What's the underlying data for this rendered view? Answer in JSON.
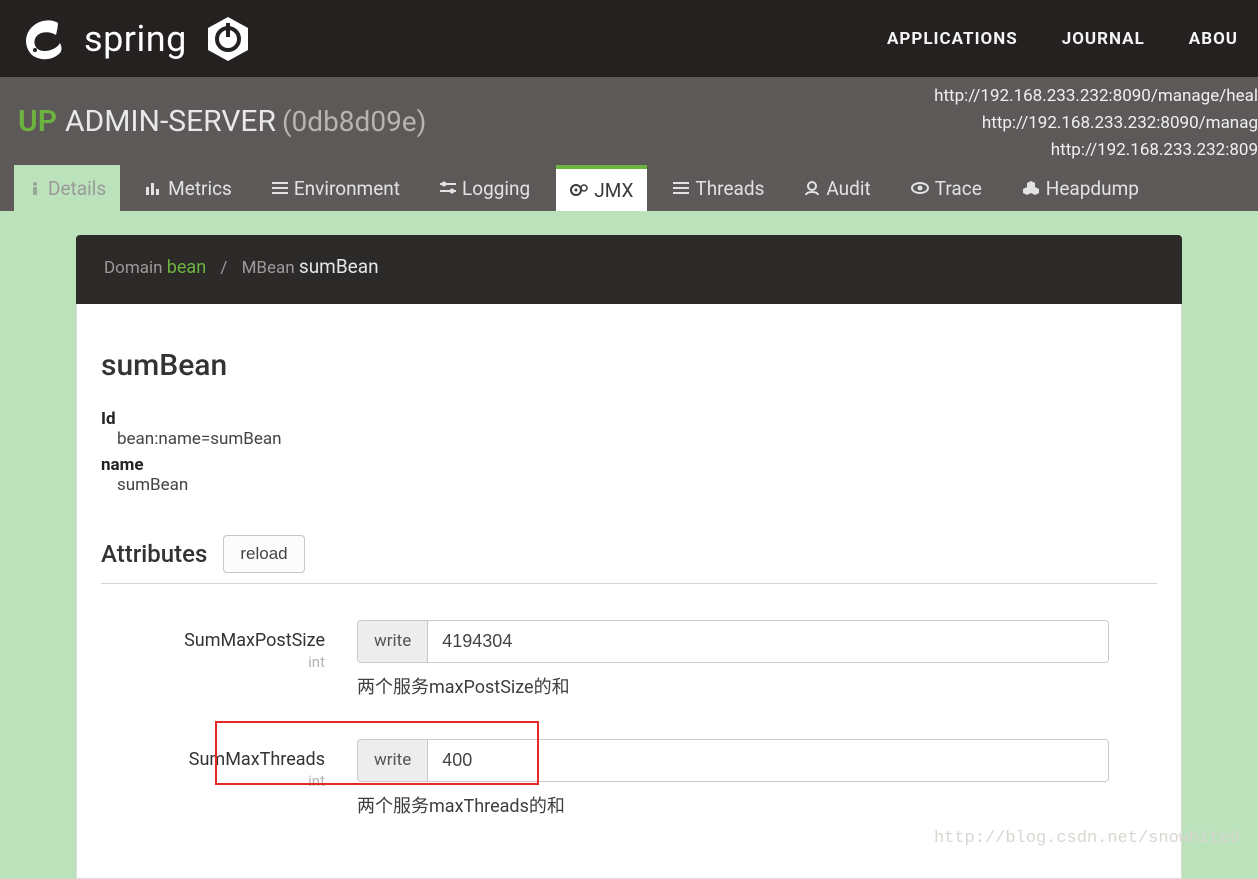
{
  "brand": "spring",
  "nav": {
    "applications": "APPLICATIONS",
    "journal": "JOURNAL",
    "about": "ABOU"
  },
  "sub": {
    "status": "UP",
    "name": "ADMIN-SERVER",
    "id": "(0db8d09e)",
    "endpoints": {
      "e0": "http://192.168.233.232:8090/manage/heal",
      "e1": "http://192.168.233.232:8090/manag",
      "e2": "http://192.168.233.232:809"
    }
  },
  "tabs": {
    "details": "Details",
    "metrics": "Metrics",
    "environment": "Environment",
    "logging": "Logging",
    "jmx": "JMX",
    "threads": "Threads",
    "audit": "Audit",
    "trace": "Trace",
    "heapdump": "Heapdump"
  },
  "crumb": {
    "domain_label": "Domain",
    "domain_value": "bean",
    "mbean_label": "MBean",
    "mbean_value": "sumBean"
  },
  "mbean": {
    "title": "sumBean",
    "id_label": "Id",
    "id_value": "bean:name=sumBean",
    "name_label": "name",
    "name_value": "sumBean"
  },
  "attributes": {
    "heading": "Attributes",
    "reload": "reload",
    "write_label": "write",
    "items": {
      "0": {
        "name": "SumMaxPostSize",
        "type": "int",
        "value": "4194304",
        "desc": "两个服务maxPostSize的和"
      },
      "1": {
        "name": "SumMaxThreads",
        "type": "int",
        "value": "400",
        "desc": "两个服务maxThreads的和"
      }
    }
  },
  "watermark": "http://blog.csdn.net/snowhite9"
}
